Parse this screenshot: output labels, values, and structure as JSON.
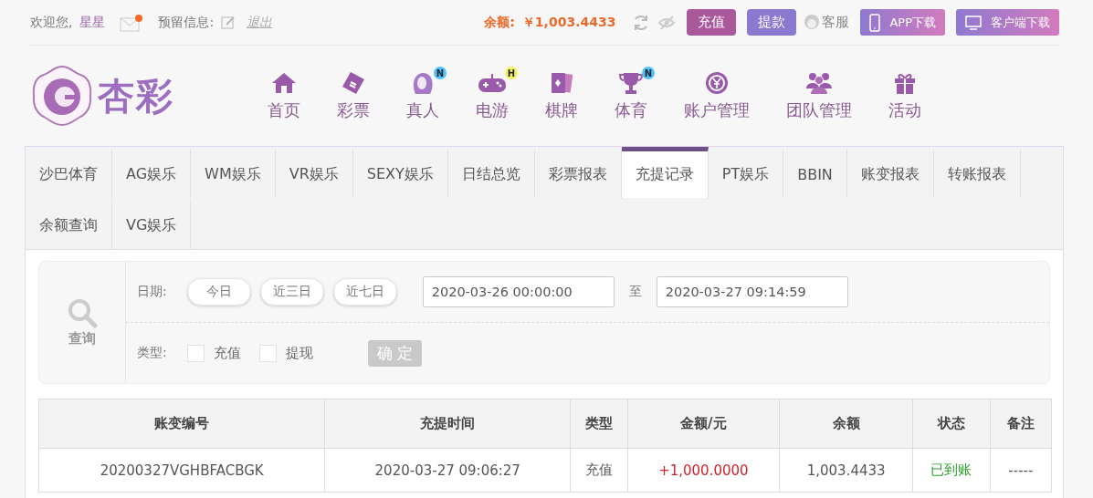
{
  "top_bar": {
    "greeting": "欢迎您,",
    "username": "星星",
    "has_new_mail": true,
    "note_label": "预留信息:",
    "logout": "退出",
    "balance_label": "余额:",
    "balance": "￥1,003.4433",
    "buttons": [
      {
        "label": "充值",
        "kind": "deposit"
      },
      {
        "label": "提款",
        "kind": "withdraw"
      }
    ],
    "service": "客服",
    "downloads": [
      {
        "label": "APP下载",
        "kind": "phone"
      },
      {
        "label": "客户端下载",
        "kind": "desktop"
      }
    ]
  },
  "logo": {
    "text": "杏彩"
  },
  "nav": [
    {
      "label": "首页"
    },
    {
      "label": "彩票"
    },
    {
      "label": "真人",
      "badge": "N",
      "color": "#4fc3f7"
    },
    {
      "label": "电游",
      "badge": "H",
      "color": "#f5f55a"
    },
    {
      "label": "棋牌"
    },
    {
      "label": "体育",
      "badge": "N",
      "color": "#4fc3f7"
    },
    {
      "label": "账户管理"
    },
    {
      "label": "团队管理"
    },
    {
      "label": "活动"
    }
  ],
  "tabs": [
    {
      "label": "沙巴体育",
      "selected": false
    },
    {
      "label": "AG娱乐",
      "selected": false
    },
    {
      "label": "WM娱乐",
      "selected": false
    },
    {
      "label": "VR娱乐",
      "selected": false
    },
    {
      "label": "SEXY娱乐",
      "selected": false
    },
    {
      "label": "日结总览",
      "selected": false
    },
    {
      "label": "彩票报表",
      "selected": false
    },
    {
      "label": "充提记录",
      "selected": true
    },
    {
      "label": "PT娱乐",
      "selected": false
    },
    {
      "label": "BBIN",
      "selected": false
    },
    {
      "label": "账变报表",
      "selected": false
    },
    {
      "label": "转账报表",
      "selected": false
    },
    {
      "label": "余额查询",
      "selected": false
    },
    {
      "label": "VG娱乐",
      "selected": false
    }
  ],
  "filter": {
    "search_label": "查询",
    "date_label": "日期:",
    "quick_dates": [
      {
        "label": "今日",
        "selected": false
      },
      {
        "label": "近三日",
        "selected": false
      },
      {
        "label": "近七日",
        "selected": false
      }
    ],
    "date_from": "2020-03-26 00:00:00",
    "to_label": "至",
    "date_to": "2020-03-27 09:14:59",
    "type_label": "类型:",
    "types": [
      {
        "label": "充值",
        "checked": false
      },
      {
        "label": "提现",
        "checked": false
      }
    ],
    "confirm": "确 定"
  },
  "table": {
    "columns": [
      "账变编号",
      "充提时间",
      "类型",
      "金额/元",
      "余额",
      "状态",
      "备注"
    ],
    "rows": [
      [
        "20200327VGHBFACBGK",
        "2020-03-27 09:06:27",
        "充值",
        "+1,000.0000",
        "1,003.4433",
        "已到账",
        "-----"
      ]
    ]
  }
}
